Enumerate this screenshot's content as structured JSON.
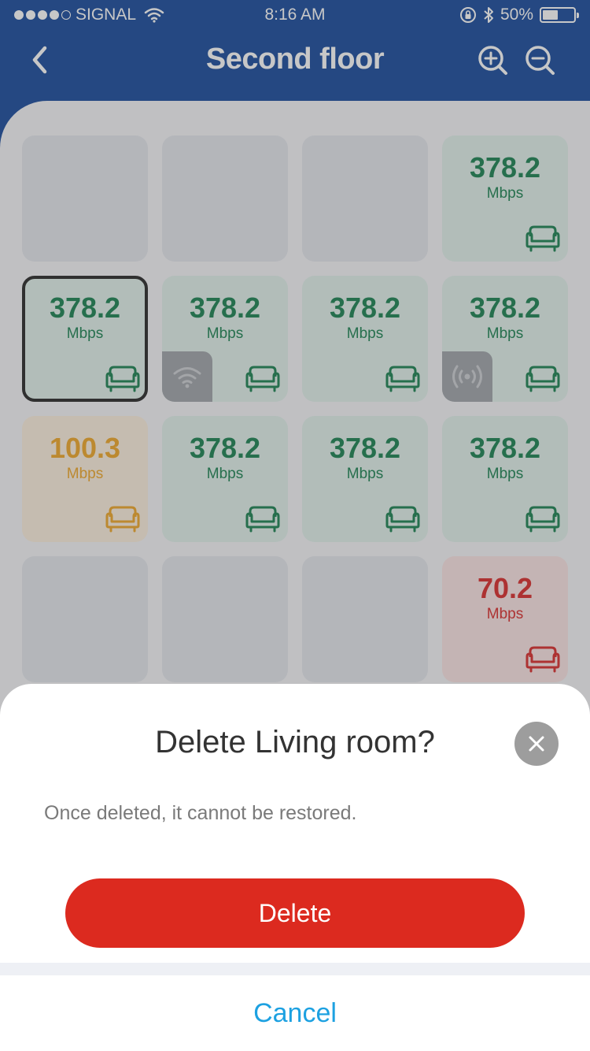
{
  "status_bar": {
    "carrier": "SIGNAL",
    "time": "8:16 AM",
    "battery_percent": "50%",
    "battery_level": 0.5,
    "signal_bars_filled": 4,
    "signal_bars_total": 5
  },
  "nav": {
    "title": "Second floor",
    "back_icon": "chevron-left-icon",
    "zoom_in_icon": "zoom-in-icon",
    "zoom_out_icon": "zoom-out-icon"
  },
  "grid": {
    "rows": [
      [
        {
          "state": "empty"
        },
        {
          "state": "empty"
        },
        {
          "state": "empty"
        },
        {
          "state": "good",
          "speed": "378.2",
          "unit": "Mbps",
          "icon": "sofa-icon"
        }
      ],
      [
        {
          "state": "good",
          "speed": "378.2",
          "unit": "Mbps",
          "icon": "sofa-icon",
          "selected": true
        },
        {
          "state": "good",
          "speed": "378.2",
          "unit": "Mbps",
          "icon": "sofa-icon",
          "device": "wifi-icon"
        },
        {
          "state": "good",
          "speed": "378.2",
          "unit": "Mbps",
          "icon": "sofa-icon"
        },
        {
          "state": "good",
          "speed": "378.2",
          "unit": "Mbps",
          "icon": "sofa-icon",
          "device": "broadcast-icon"
        }
      ],
      [
        {
          "state": "medium",
          "speed": "100.3",
          "unit": "Mbps",
          "icon": "sofa-icon"
        },
        {
          "state": "good",
          "speed": "378.2",
          "unit": "Mbps",
          "icon": "sofa-icon"
        },
        {
          "state": "good",
          "speed": "378.2",
          "unit": "Mbps",
          "icon": "sofa-icon"
        },
        {
          "state": "good",
          "speed": "378.2",
          "unit": "Mbps",
          "icon": "sofa-icon"
        }
      ],
      [
        {
          "state": "empty"
        },
        {
          "state": "empty"
        },
        {
          "state": "empty"
        },
        {
          "state": "poor",
          "speed": "70.2",
          "unit": "Mbps",
          "icon": "sofa-icon"
        }
      ]
    ]
  },
  "colors": {
    "header_blue": "#0a3f96",
    "good": "#0c7a47",
    "medium": "#eea21b",
    "poor": "#d81e1e",
    "delete_red": "#dc2a1f",
    "cancel_blue": "#1da1e1"
  },
  "dialog": {
    "title": "Delete Living room?",
    "message": "Once deleted, it cannot be restored.",
    "delete_label": "Delete",
    "cancel_label": "Cancel",
    "close_icon": "close-icon"
  }
}
